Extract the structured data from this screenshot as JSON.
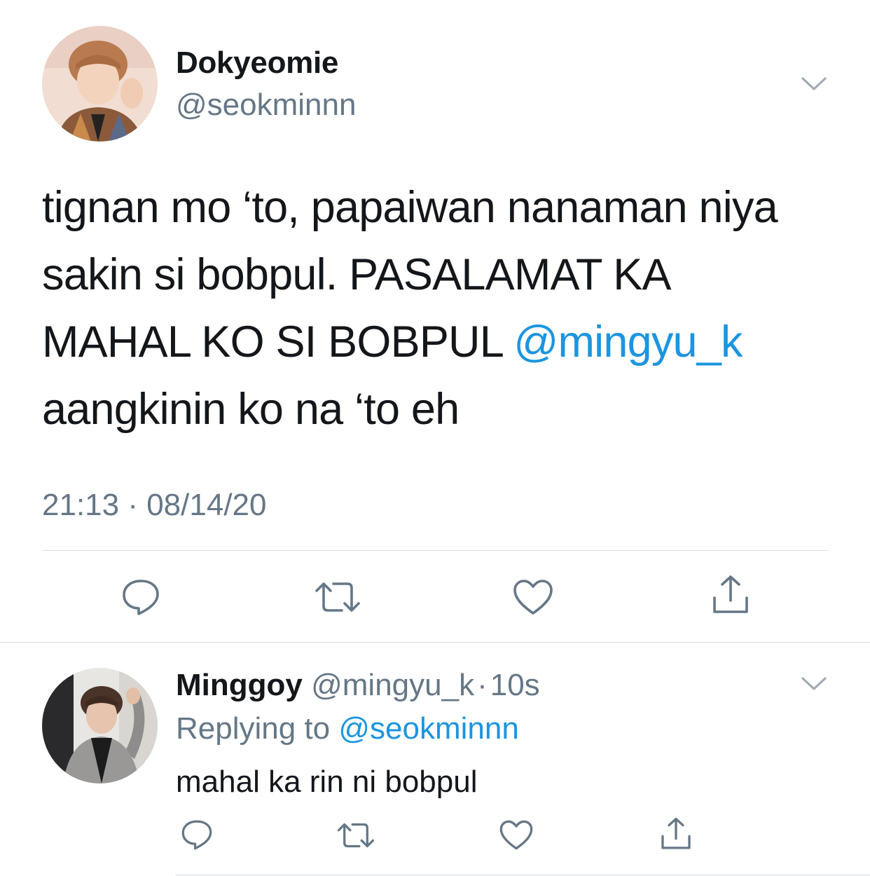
{
  "main_tweet": {
    "display_name": "Dokyeomie",
    "handle": "@seokminnn",
    "text_lines": [
      "tignan mo ‘to, papaiwan nanaman niya",
      "sakin si bobpul. PASALAMAT KA",
      "MAHAL KO SI BOBPUL "
    ],
    "mention": "@mingyu_k",
    "text_last": "aangkinin ko na ‘to eh",
    "timestamp": "21:13 · 08/14/20"
  },
  "reply_tweet": {
    "display_name": "Minggoy",
    "handle": "@mingyu_k",
    "time_separator": "·",
    "time": "10s",
    "replying_prefix": "Replying to ",
    "replying_to": "@seokminnn",
    "text": "mahal ka rin ni bobpul"
  },
  "icons": {
    "action_bar": [
      "reply-icon",
      "retweet-icon",
      "like-icon",
      "share-icon"
    ],
    "menu": "chevron-down-icon"
  },
  "colors": {
    "text": "#14171a",
    "secondary": "#657786",
    "link": "#1b95e0",
    "divider": "#d6dce1",
    "background": "#ffffff"
  }
}
